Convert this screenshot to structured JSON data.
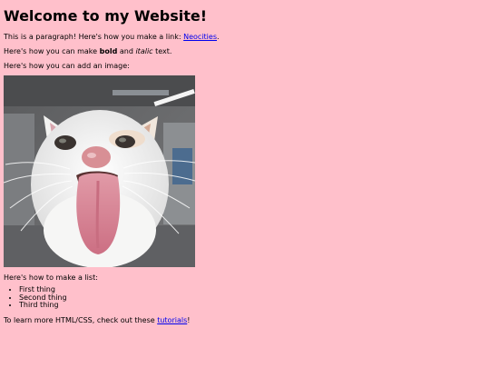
{
  "page": {
    "heading": "Welcome to my Website!",
    "link_paragraph": {
      "before": "This is a paragraph! Here's how you make a link: ",
      "link_text": "Neocities",
      "after": "."
    },
    "format_paragraph": {
      "before": "Here's how you can make ",
      "bold_text": "bold",
      "middle": " and ",
      "italic_text": "italic",
      "after": " text."
    },
    "image_paragraph": "Here's how you can add an image:",
    "image": {
      "subject": "white cat sticking out tongue",
      "colors": {
        "fur": "#f2f2f0",
        "tongue": "#d97c8f",
        "nose": "#d88f95",
        "background": "#6d6e70"
      }
    },
    "list_intro": "Here's how to make a list:",
    "list_items": [
      "First thing",
      "Second thing",
      "Third thing"
    ],
    "tutorial_paragraph": {
      "before": "To learn more HTML/CSS, check out these ",
      "link_text": "tutorials",
      "after": "!"
    }
  },
  "colors": {
    "background": "#ffc0cb",
    "text": "#000000",
    "link": "#0000ee"
  }
}
